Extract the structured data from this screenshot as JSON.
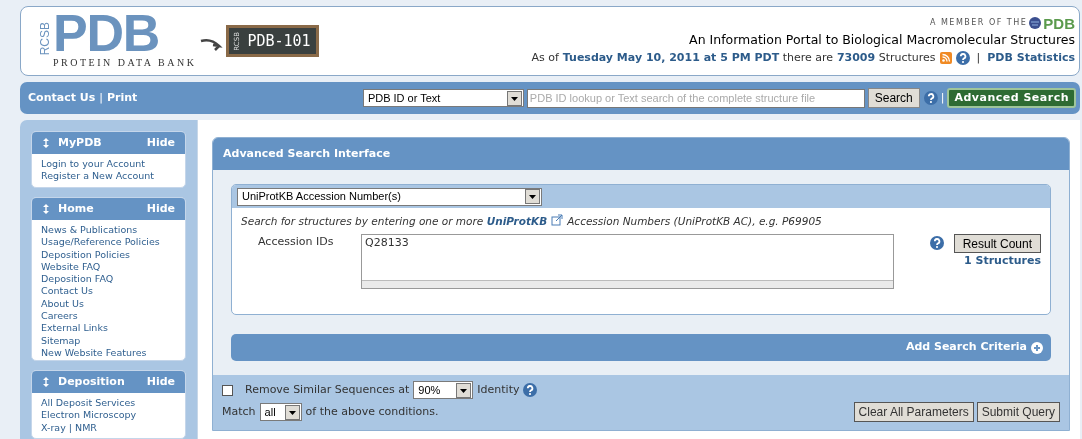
{
  "header": {
    "logo": {
      "rcsb": "RCSB",
      "pdb": "PDB",
      "subtitle": "PROTEIN DATA BANK"
    },
    "pdb101": {
      "rcsb": "RCSB",
      "title": "PDB-101"
    },
    "member": {
      "prefix": "A MEMBER OF THE",
      "brand": "PDB"
    },
    "tagline": "An Information Portal to Biological Macromolecular Structures",
    "status": [
      {
        "kind": "plain",
        "text": "As of"
      },
      {
        "kind": "link",
        "text": "Tuesday May 10, 2011 at 5 PM PDT"
      },
      {
        "kind": "plain",
        "text": "there are"
      },
      {
        "kind": "link",
        "text": "73009"
      },
      {
        "kind": "plain",
        "text": "Structures"
      }
    ],
    "separator": "|",
    "stats_link": "PDB Statistics"
  },
  "navbar": {
    "links": [
      "Contact Us",
      "Print"
    ],
    "separator": "|",
    "search_type": "PDB ID or Text",
    "search_placeholder": "PDB ID lookup or Text search of the complete structure file",
    "search_button": "Search",
    "separator_2": "|",
    "advanced_button": "Advanced Search"
  },
  "sidebar": {
    "sections": [
      {
        "title": "MyPDB",
        "hide": "Hide",
        "items": [
          "Login to your Account",
          "Register a New Account"
        ]
      },
      {
        "title": "Home",
        "hide": "Hide",
        "items": [
          "News & Publications",
          "Usage/Reference Policies",
          "Deposition Policies",
          "Website FAQ",
          "Deposition FAQ",
          "Contact Us",
          "About Us",
          "Careers",
          "External Links",
          "Sitemap",
          "New Website Features"
        ]
      },
      {
        "title": "Deposition",
        "hide": "Hide",
        "items": [
          "All Deposit Services",
          "Electron Microscopy",
          "X-ray | NMR"
        ]
      }
    ]
  },
  "main": {
    "title": "Advanced Search Interface",
    "criteria": {
      "type": "UniProtKB Accession Number(s)",
      "description_before": "Search for structures by entering one or more",
      "description_link": "UniProtKB",
      "description_after": "Accession Numbers (UniProtKB AC), e.g. P69905",
      "field_label": "Accession IDs",
      "field_value": "Q28133",
      "count_button": "Result Count",
      "count_result": "1 Structures"
    },
    "add_criteria": "Add Search Criteria",
    "footer": {
      "remove_similar": {
        "checked": false,
        "label": "Remove Similar Sequences at",
        "percent": "90%",
        "suffix": "Identity"
      },
      "match": {
        "prefix": "Match",
        "value": "all",
        "suffix": "of the above conditions."
      },
      "buttons": [
        "Clear All Parameters",
        "Submit Query"
      ]
    }
  }
}
